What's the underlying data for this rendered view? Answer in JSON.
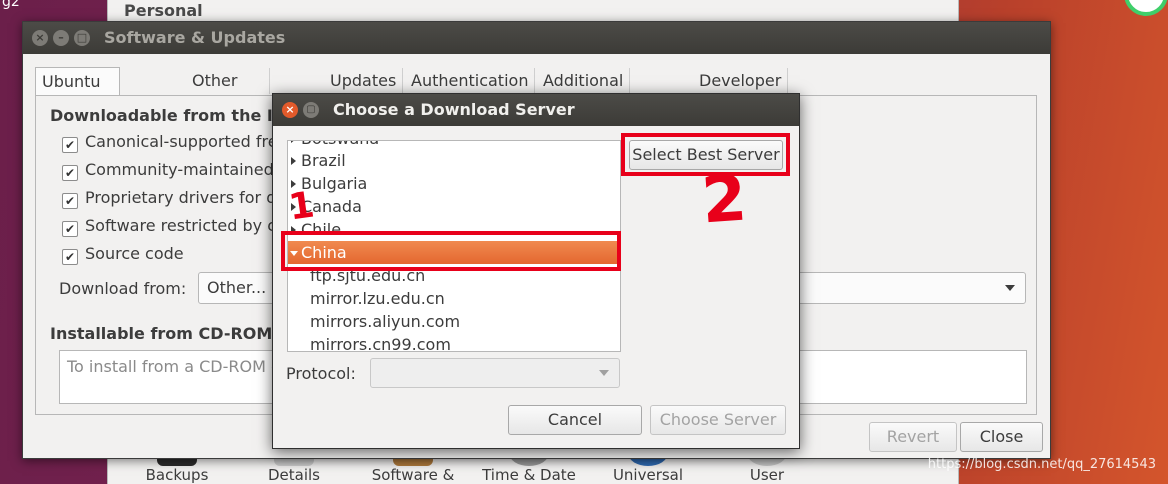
{
  "desktop": {
    "corner_text": "g2",
    "watermark": "https://blog.csdn.net/qq_27614543"
  },
  "settings_window": {
    "heading": "Personal",
    "icons": [
      {
        "label": "Backups"
      },
      {
        "label": "Details"
      },
      {
        "label": "Software &"
      },
      {
        "label": "Time & Date"
      },
      {
        "label": "Universal"
      },
      {
        "label": "User"
      }
    ]
  },
  "software_updates": {
    "title": "Software & Updates",
    "tabs": [
      {
        "label": "Ubuntu Software"
      },
      {
        "label": "Other Software"
      },
      {
        "label": "Updates"
      },
      {
        "label": "Authentication"
      },
      {
        "label": "Additional Drivers"
      },
      {
        "label": "Developer Options"
      }
    ],
    "downloadable_title": "Downloadable from the Inte",
    "checkboxes": [
      {
        "label": "Canonical-supported fre",
        "checked": true
      },
      {
        "label": "Community-maintained f",
        "checked": true
      },
      {
        "label": "Proprietary drivers for d",
        "checked": true
      },
      {
        "label": "Software restricted by c",
        "checked": true
      },
      {
        "label": "Source code",
        "checked": true
      }
    ],
    "download_from_label": "Download from:",
    "download_from_value": "Other...",
    "installable_title": "Installable from CD-ROM/DV",
    "cd_placeholder": "To install from a CD-ROM c",
    "revert_label": "Revert",
    "close_label": "Close"
  },
  "dialog": {
    "title": "Choose a Download Server",
    "tree": [
      {
        "label": "Botswana",
        "type": "country"
      },
      {
        "label": "Brazil",
        "type": "country"
      },
      {
        "label": "Bulgaria",
        "type": "country"
      },
      {
        "label": "Canada",
        "type": "country"
      },
      {
        "label": "Chile",
        "type": "country"
      },
      {
        "label": "China",
        "type": "country",
        "selected": true,
        "expanded": true
      },
      {
        "label": "ftp.sjtu.edu.cn",
        "type": "mirror"
      },
      {
        "label": "mirror.lzu.edu.cn",
        "type": "mirror"
      },
      {
        "label": "mirrors.aliyun.com",
        "type": "mirror"
      },
      {
        "label": "mirrors.cn99.com",
        "type": "mirror"
      }
    ],
    "select_best_label": "Select Best Server",
    "protocol_label": "Protocol:",
    "protocol_value": "",
    "cancel_label": "Cancel",
    "choose_label": "Choose Server"
  },
  "annotations": {
    "step1": "1",
    "step2": "2",
    "color": "#e8001a"
  },
  "colors": {
    "selection": "#e4672f",
    "titlebar": "#3c3b37",
    "window_bg": "#f2f1f0"
  }
}
